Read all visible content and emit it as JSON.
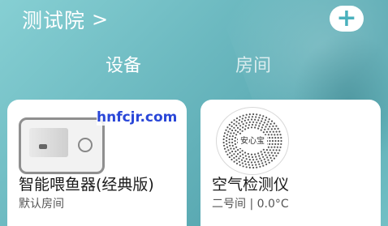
{
  "header": {
    "title": "测试院",
    "chevron": ">"
  },
  "add_button": {
    "label": "+"
  },
  "tabs": [
    {
      "label": "设备"
    },
    {
      "label": "房间"
    }
  ],
  "devices": [
    {
      "name": "智能喂鱼器(经典版)",
      "room": "默认房间",
      "watermark": "hnfcjr.com"
    },
    {
      "name": "空气检测仪",
      "room": "二号间 | 0.0°C",
      "brand": "安心宝"
    }
  ],
  "colors": {
    "background": "#6cb9c0",
    "accent": "#4ab1bd",
    "card": "#ffffff"
  }
}
